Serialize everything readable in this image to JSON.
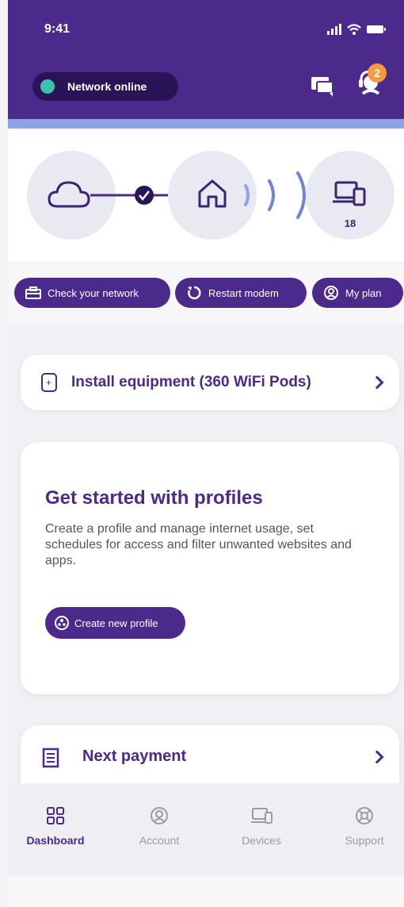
{
  "status_bar": {
    "time": "9:41"
  },
  "header": {
    "network_status": "Network online",
    "notification_count": "2"
  },
  "diagram": {
    "device_count": "18"
  },
  "actions": [
    {
      "label": "Check your network",
      "icon": "toolbox-icon"
    },
    {
      "label": "Restart modem",
      "icon": "restart-icon"
    },
    {
      "label": "My plan",
      "icon": "user-circle-icon"
    }
  ],
  "install_card": {
    "label": "Install equipment (360 WiFi Pods)"
  },
  "profiles_card": {
    "title": "Get started with profiles",
    "description": "Create a profile and manage internet usage, set schedules for access and filter unwanted websites and apps.",
    "button_label": "Create new profile"
  },
  "payment_card": {
    "label": "Next payment"
  },
  "bottom_nav": [
    {
      "label": "Dashboard",
      "icon": "grid-icon",
      "active": true
    },
    {
      "label": "Account",
      "icon": "user-circle-icon",
      "active": false
    },
    {
      "label": "Devices",
      "icon": "devices-icon",
      "active": false
    },
    {
      "label": "Support",
      "icon": "lifebuoy-icon",
      "active": false
    }
  ],
  "colors": {
    "brand": "#4b2a8c",
    "header_dark": "#2a1457",
    "online": "#3cc2a8",
    "badge": "#f39a3a",
    "accent_bar": "#8fa4e6"
  }
}
